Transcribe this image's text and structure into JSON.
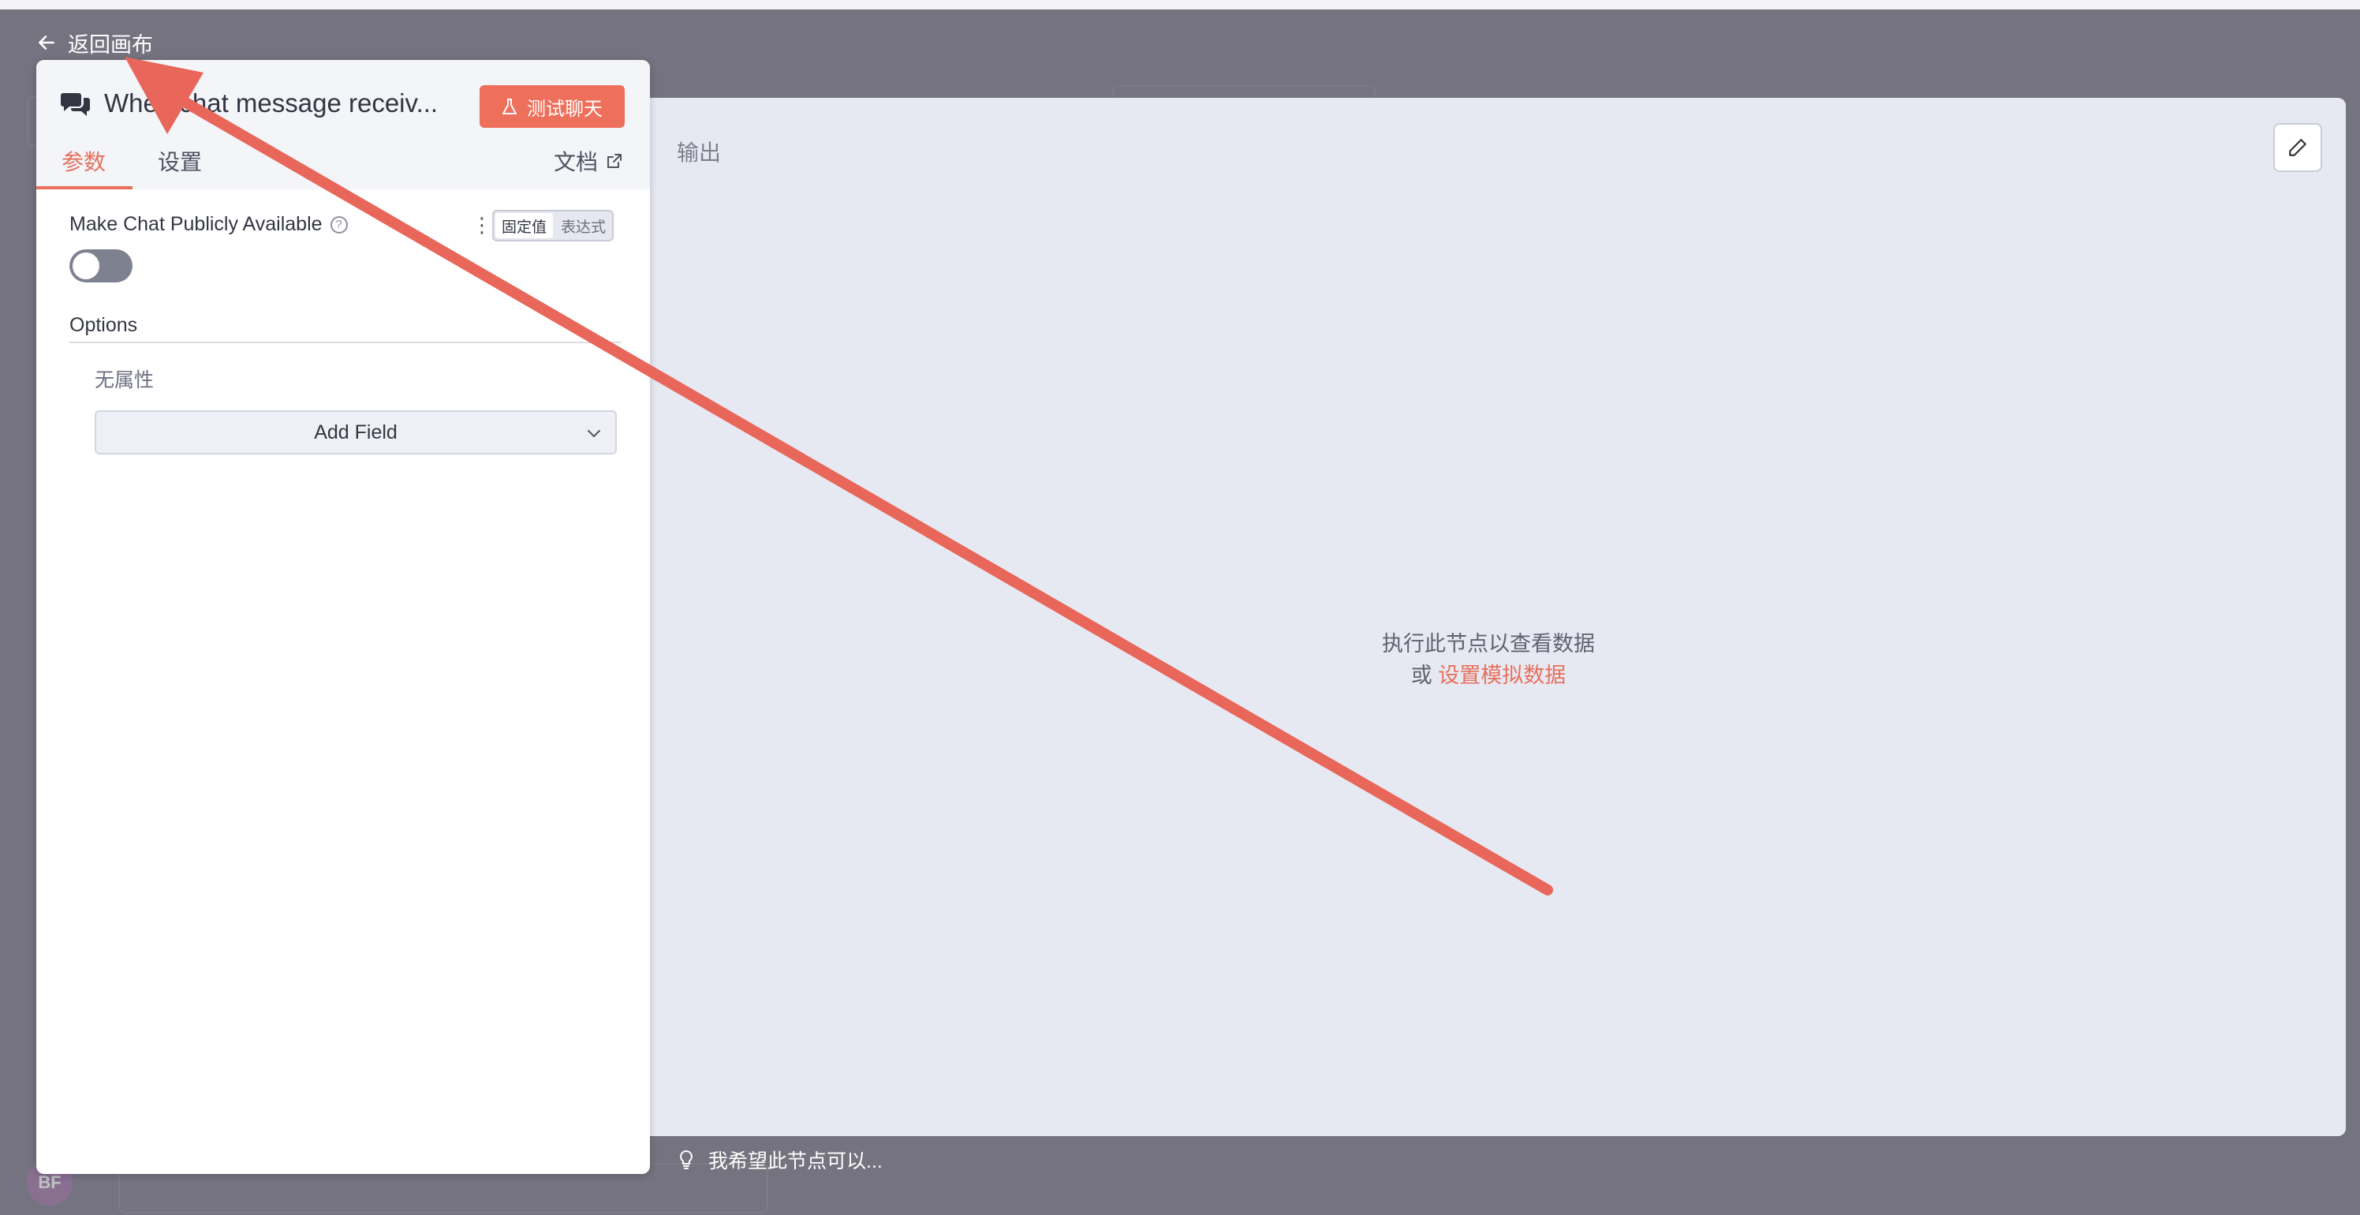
{
  "nav": {
    "back_label": "返回画布"
  },
  "node": {
    "title": "When chat message receiv...",
    "test_button_label": "测试聊天"
  },
  "tabs": [
    {
      "label": "参数",
      "active": true
    },
    {
      "label": "设置",
      "active": false
    }
  ],
  "docs_label": "文档",
  "parameters": {
    "make_public": {
      "label": "Make Chat Publicly Available",
      "enabled": false,
      "mode_options": [
        "固定值",
        "表达式"
      ],
      "selected_mode": "固定值"
    },
    "options": {
      "label": "Options",
      "empty_text": "无属性",
      "add_field_label": "Add Field"
    }
  },
  "output": {
    "title": "输出",
    "empty_line1": "执行此节点以查看数据",
    "empty_or": "或",
    "mock_link": "设置模拟数据"
  },
  "feedback": {
    "text": "我希望此节点可以..."
  },
  "user": {
    "initials": "BF"
  },
  "colors": {
    "accent": "#ee6f5b",
    "annotation_arrow": "#e8665a",
    "backdrop": "#75737f",
    "output_bg": "#e7e9f2"
  }
}
